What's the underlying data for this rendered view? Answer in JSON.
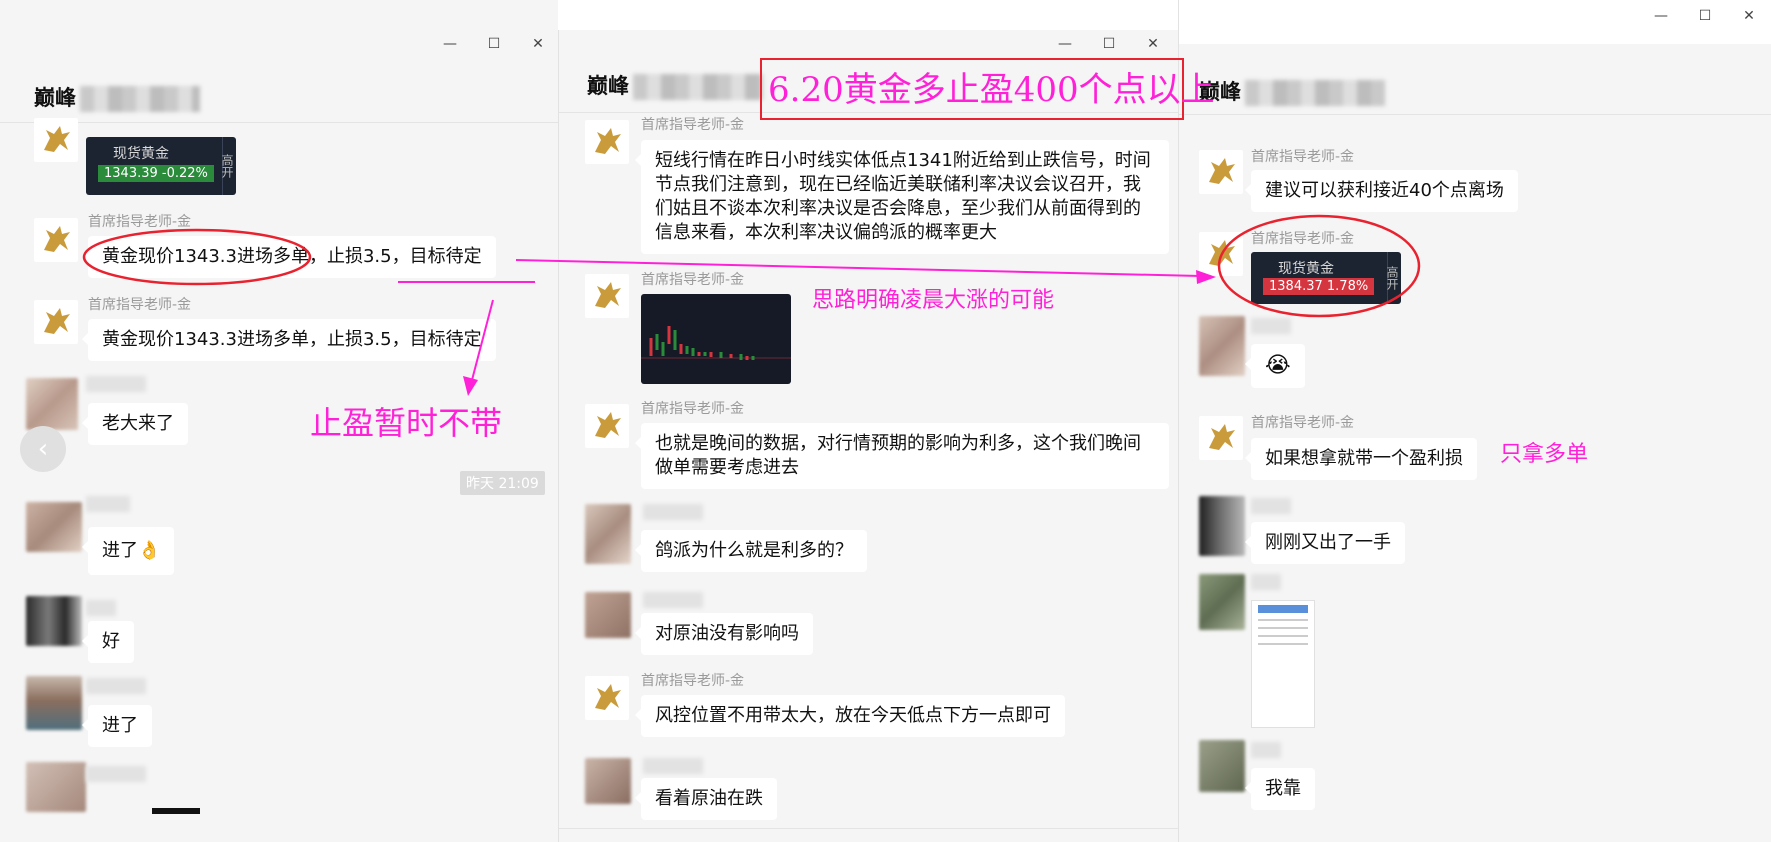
{
  "colors": {
    "annotation": "#ff21d8",
    "circle": "#e8232f",
    "rise": "#d4353f",
    "fall": "#2a8c3a",
    "bg": "#f5f5f5"
  },
  "left": {
    "title": "巅峰",
    "controls": {
      "min": "—",
      "max": "☐",
      "close": "✕"
    },
    "stock_card": {
      "name": "现货黄金",
      "value": "1343.39  -0.22%",
      "side": "高开"
    },
    "messages": [
      {
        "nick": "首席指导老师-金",
        "text": "黄金现价1343.3进场多单，止损3.5，目标待定"
      },
      {
        "nick": "首席指导老师-金",
        "text": "黄金现价1343.3进场多单，止损3.5，目标待定"
      },
      {
        "text": "老大来了"
      },
      {
        "text": "进了👌"
      },
      {
        "text": "好"
      },
      {
        "text": "进了"
      }
    ],
    "time_badge": "昨天 21:09",
    "nav_icon": "‹"
  },
  "mid": {
    "title": "巅峰",
    "controls": {
      "min": "—",
      "max": "☐",
      "close": "✕"
    },
    "messages": [
      {
        "nick": "首席指导老师-金",
        "text": "短线行情在昨日小时线实体低点1341附近给到止跌信号，时间节点我们注意到，现在已经临近美联储利率决议会议召开，我们姑且不谈本次利率决议是否会降息，至少我们从前面得到的信息来看，本次利率决议偏鸽派的概率更大"
      },
      {
        "nick": "首席指导老师-金"
      },
      {
        "nick": "首席指导老师-金",
        "text": "也就是晚间的数据，对行情预期的影响为利多，这个我们晚间做单需要考虑进去"
      },
      {
        "text": "鸽派为什么就是利多的？"
      },
      {
        "text": "对原油没有影响吗"
      },
      {
        "nick": "首席指导老师-金",
        "text": "风控位置不用带太大，放在今天低点下方一点即可"
      },
      {
        "text": "看着原油在跌"
      }
    ]
  },
  "right": {
    "title": "巅峰",
    "controls": {
      "min": "—",
      "max": "☐",
      "close": "✕"
    },
    "stock_card": {
      "name": "现货黄金",
      "value": "1384.37  1.78%",
      "side": "高开"
    },
    "messages": [
      {
        "nick": "首席指导老师-金",
        "text": "建议可以获利接近40个点离场"
      },
      {
        "nick": "首席指导老师-金"
      },
      {
        "text": "😭"
      },
      {
        "nick": "首席指导老师-金",
        "text": "如果想拿就带一个盈利损"
      },
      {
        "text": "刚刚又出了一手"
      },
      {
        "text": "我靠"
      }
    ]
  },
  "annotations": {
    "headline": "6.20黄金多止盈400个点以上",
    "no_tp": "止盈暂时不带",
    "clear_idea": "思路明确凌晨大涨的可能",
    "only_long": "只拿多单"
  }
}
